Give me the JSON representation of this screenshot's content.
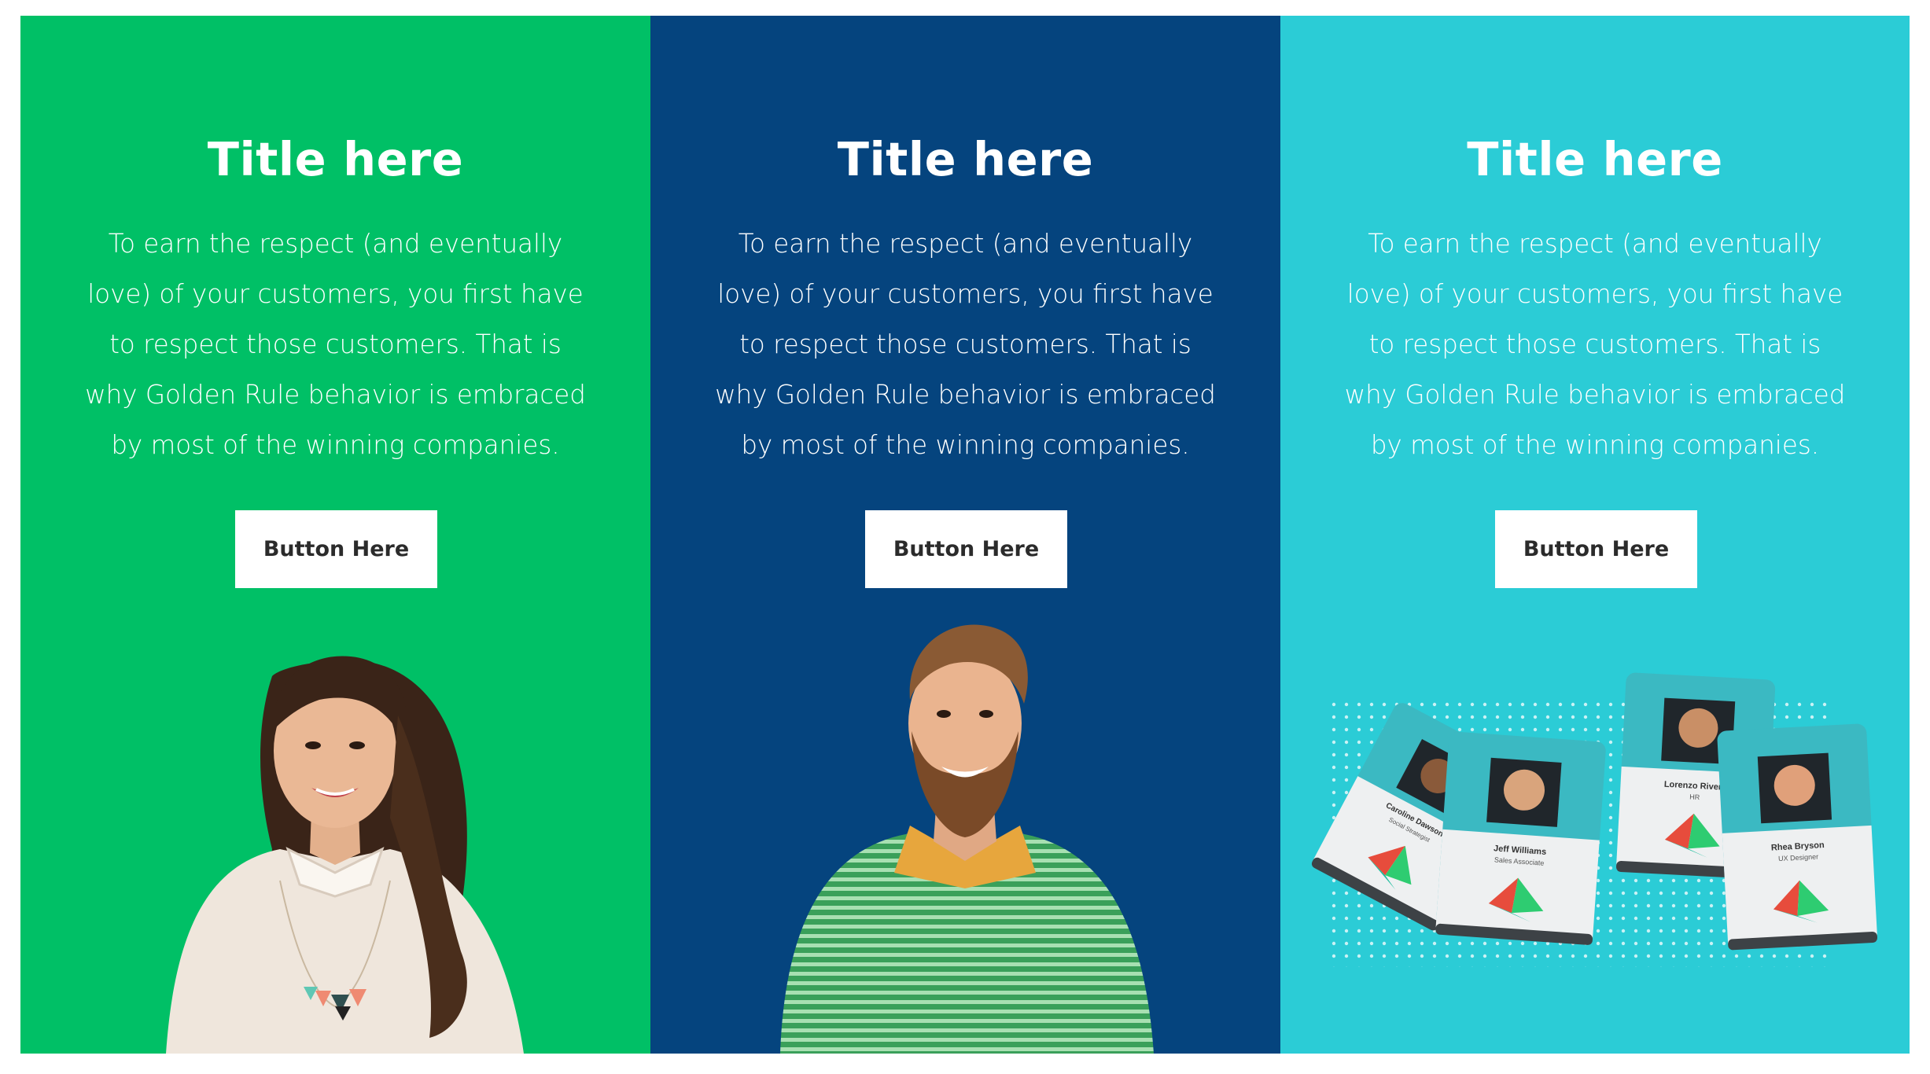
{
  "colors": {
    "panel_green": "#00c066",
    "panel_navy": "#05447e",
    "panel_teal": "#2bccd6",
    "button_bg": "#ffffff",
    "button_text": "#2b2b2b"
  },
  "panels": [
    {
      "title": "Title here",
      "body": "To earn the respect (and eventually love) of your customers, you first have to respect those customers. That is why Golden Rule behavior is embraced by most of the winning companies.",
      "button_label": "Button Here"
    },
    {
      "title": "Title here",
      "body": "To earn the respect (and eventually love) of your customers, you first have to respect those customers. That is why Golden Rule behavior is embraced by most of the winning companies.",
      "button_label": "Button Here"
    },
    {
      "title": "Title here",
      "body": "To earn the respect (and eventually love) of your customers, you first have to respect those customers. That is why Golden Rule behavior is embraced by most of the winning companies.",
      "button_label": "Button Here"
    }
  ],
  "badges": [
    {
      "name": "Caroline Dawson",
      "role": "Social Strategist"
    },
    {
      "name": "Jeff Williams",
      "role": "Sales Associate"
    },
    {
      "name": "Lorenzo Rivera",
      "role": "HR"
    },
    {
      "name": "Rhea Bryson",
      "role": "UX Designer"
    }
  ]
}
